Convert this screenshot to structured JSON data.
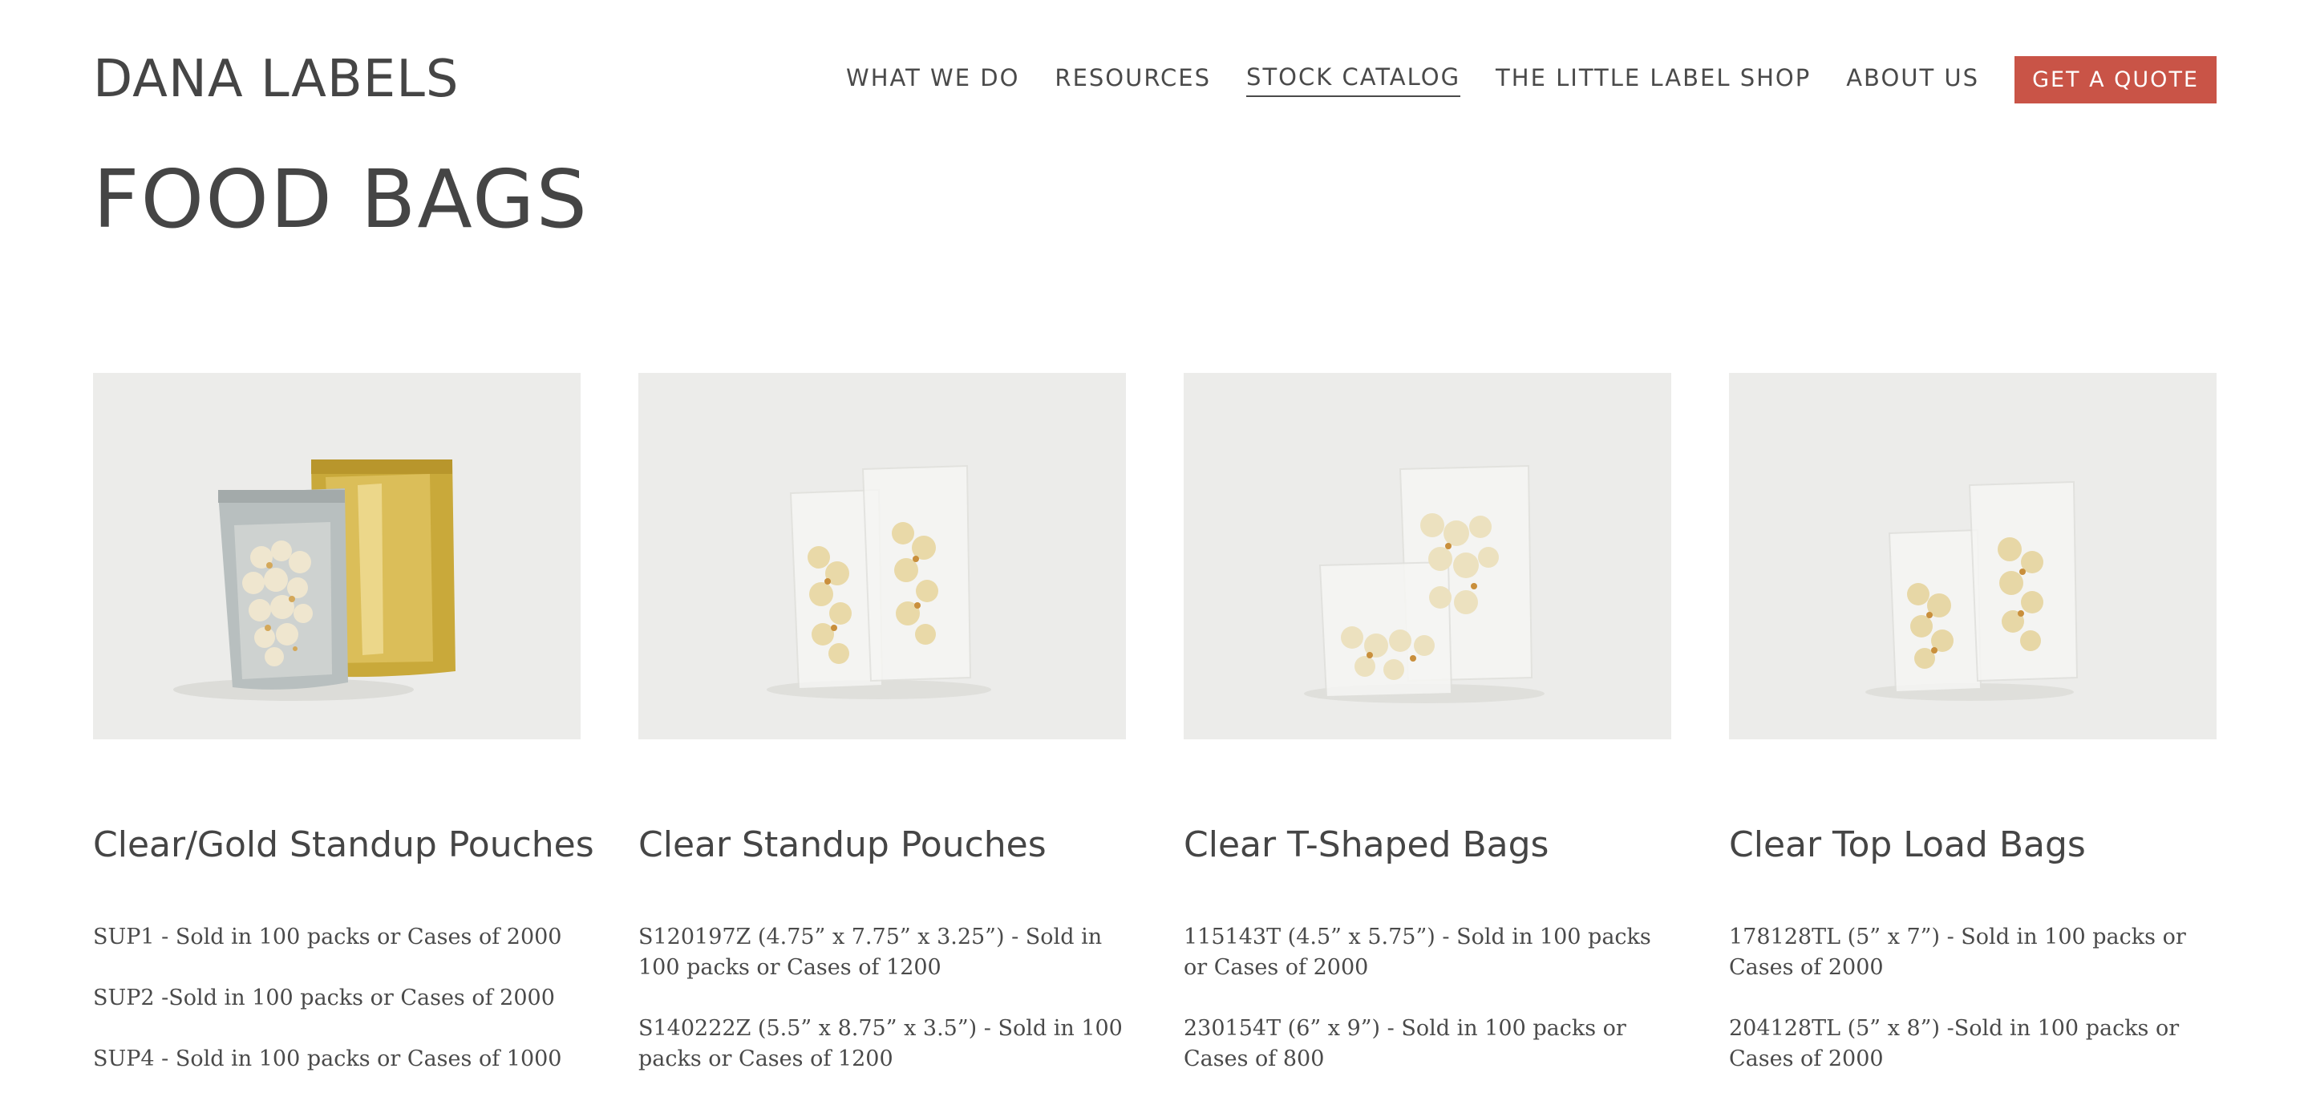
{
  "header": {
    "logo": "DANA LABELS",
    "nav": [
      {
        "label": "WHAT WE DO"
      },
      {
        "label": "RESOURCES"
      },
      {
        "label": "STOCK CATALOG"
      },
      {
        "label": "THE LITTLE LABEL SHOP"
      },
      {
        "label": "ABOUT US"
      }
    ],
    "cta": "GET A QUOTE",
    "active_nav": "STOCK CATALOG"
  },
  "page": {
    "title": "FOOD BAGS"
  },
  "products": [
    {
      "title": "Clear/Gold Standup Pouches",
      "lines": [
        "SUP1 - Sold in 100 packs or Cases of 2000",
        "SUP2 -Sold in 100 packs or Cases of 2000",
        "SUP4 - Sold in 100 packs or Cases of 1000"
      ]
    },
    {
      "title": "Clear Standup Pouches",
      "lines": [
        "S120197Z (4.75” x 7.75” x 3.25”) - Sold in 100 packs or Cases of 1200",
        "S140222Z (5.5” x 8.75” x 3.5”) - Sold in 100 packs or Cases of 1200"
      ]
    },
    {
      "title": "Clear T-Shaped Bags",
      "lines": [
        "115143T (4.5” x 5.75”) - Sold in 100 packs or Cases of 2000",
        "230154T (6” x 9”) - Sold in 100 packs or Cases of 800"
      ]
    },
    {
      "title": "Clear Top Load Bags",
      "lines": [
        "178128TL (5” x 7”) - Sold in 100 packs or Cases of 2000",
        "204128TL (5” x 8”) -Sold in 100 packs or Cases of 2000"
      ]
    }
  ],
  "colors": {
    "accent": "#c95447",
    "text": "#4a4a4a",
    "photo_bg": "#ececea"
  }
}
